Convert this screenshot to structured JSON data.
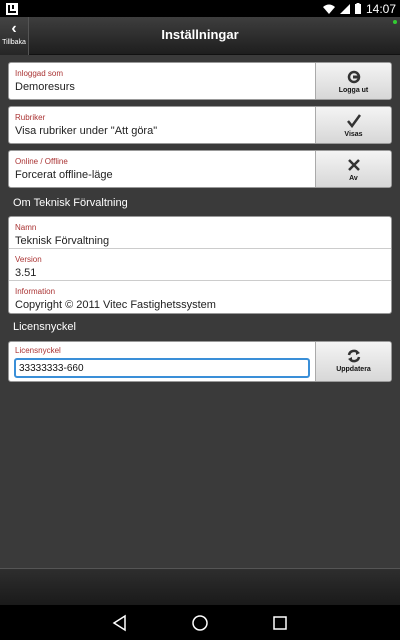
{
  "status_bar": {
    "time": "14:07",
    "icons": [
      "app-logo-icon",
      "wifi-icon",
      "signal-icon",
      "battery-icon"
    ]
  },
  "header": {
    "back_label": "Tillbaka",
    "title": "Inställningar"
  },
  "logged_in": {
    "label": "Inloggad som",
    "value": "Demoresurs",
    "button": "Logga ut"
  },
  "headings": {
    "label": "Rubriker",
    "value": "Visa rubriker under \"Att göra\"",
    "button": "Visas"
  },
  "online": {
    "label": "Online / Offline",
    "value": "Forcerat offline-läge",
    "button": "Av"
  },
  "about": {
    "heading": "Om Teknisk Förvaltning",
    "rows": [
      {
        "label": "Namn",
        "value": "Teknisk Förvaltning"
      },
      {
        "label": "Version",
        "value": "3.51"
      },
      {
        "label": "Information",
        "value": "Copyright © 2011 Vitec Fastighetssystem"
      }
    ]
  },
  "license": {
    "heading": "Licensnyckel",
    "label": "Licensnyckel",
    "value": "33333333-660",
    "button": "Uppdatera"
  },
  "colors": {
    "accent_label": "#aa3333",
    "input_focus": "#3a8fd8",
    "background": "#3a3a3a"
  }
}
